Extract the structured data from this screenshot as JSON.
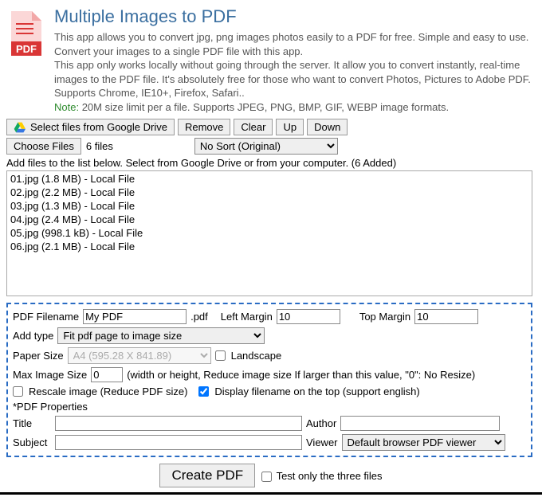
{
  "header": {
    "title": "Multiple Images to PDF",
    "desc1": "This app allows you to convert jpg, png images photos easily to a PDF for free. Simple and easy to use. Convert your images to a single PDF file with this app.",
    "desc2": "This app only works locally without going through the server. It allow you to convert instantly, real-time images to the PDF file. It's absolutely free for those who want to convert Photos, Pictures to Adobe PDF. Supports Chrome, IE10+, Firefox, Safari..",
    "note_label": "Note:",
    "note_text": " 20M size limit per a file. Supports JPEG, PNG, BMP, GIF, WEBP image formats."
  },
  "toolbar": {
    "gdrive": "Select files from Google Drive",
    "remove": "Remove",
    "clear": "Clear",
    "up": "Up",
    "down": "Down",
    "choose_files": "Choose Files",
    "chosen_text": "6 files",
    "sort_value": "No Sort (Original)"
  },
  "hint": "Add files to the list below. Select from Google Drive or from your computer. (6 Added)",
  "files": [
    "01.jpg (1.8 MB) - Local File",
    "02.jpg (2.2 MB) - Local File",
    "03.jpg (1.3 MB) - Local File",
    "04.jpg (2.4 MB) - Local File",
    "05.jpg (998.1 kB) - Local File",
    "06.jpg (2.1 MB) - Local File"
  ],
  "opts": {
    "filename_label": "PDF Filename",
    "filename_value": "My PDF",
    "filename_ext": ".pdf",
    "left_margin_label": "Left Margin",
    "left_margin_value": "10",
    "top_margin_label": "Top Margin",
    "top_margin_value": "10",
    "add_type_label": "Add type",
    "add_type_value": "Fit pdf page to image size",
    "paper_size_label": "Paper Size",
    "paper_size_value": "A4 (595.28 X 841.89)",
    "landscape_label": "Landscape",
    "max_image_label": "Max Image Size",
    "max_image_value": "0",
    "max_image_hint": "(width or height, Reduce image size If larger than this value, \"0\": No Resize)",
    "rescale_label": "Rescale image (Reduce PDF size)",
    "display_fn_label": "Display filename on the top (support english)",
    "props_header": "*PDF Properties",
    "title_label": "Title",
    "author_label": "Author",
    "subject_label": "Subject",
    "viewer_label": "Viewer",
    "viewer_value": "Default browser PDF viewer"
  },
  "bottom": {
    "create": "Create PDF",
    "test_label": "Test only the three files"
  }
}
